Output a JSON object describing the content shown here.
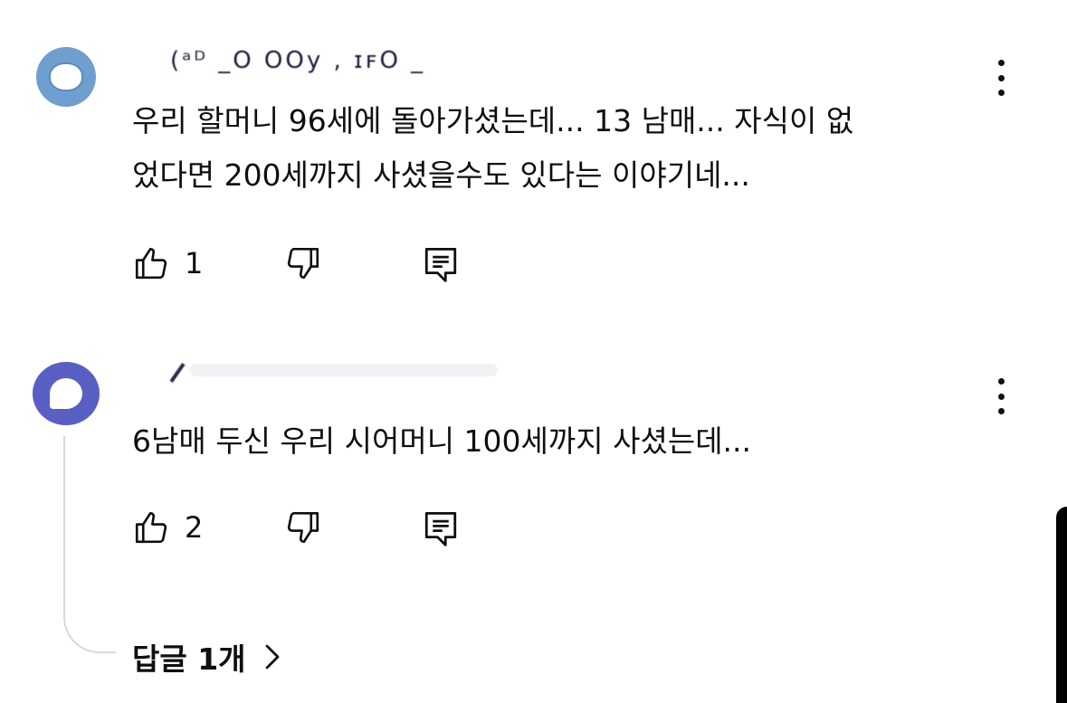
{
  "comments": [
    {
      "username": "(ᵃᴰ  _O OOy  , ɪꜰO _",
      "text_line1": "우리 할머니 96세에 돌아가셨는데... 13 남매... 자식이 없",
      "text_line2": "었다면 200세까지 사셨을수도 있다는 이야기네...",
      "likes": "1",
      "avatar_color": "#6f9fcf",
      "icons": [
        "thumbs-up-icon",
        "thumbs-down-icon",
        "reply-icon",
        "more-vertical-icon"
      ]
    },
    {
      "username": "",
      "text_line1": "6남매 두신 우리 시어머니 100세까지 사셨는데...",
      "likes": "2",
      "avatar_color": "#5a5fc4",
      "icons": [
        "thumbs-up-icon",
        "thumbs-down-icon",
        "reply-icon",
        "more-vertical-icon"
      ]
    }
  ],
  "replies_link": {
    "label": "답글 1개",
    "icon": "chevron-right-icon"
  }
}
